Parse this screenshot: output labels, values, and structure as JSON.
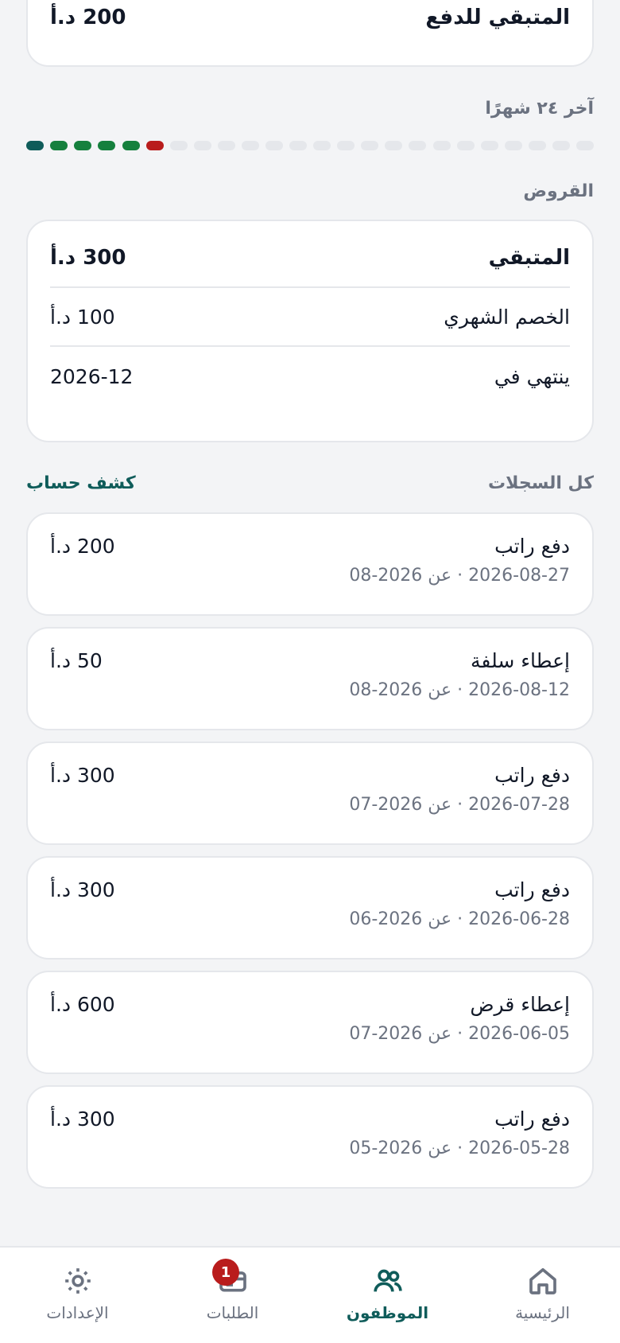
{
  "summary": {
    "label": "المتبقي للدفع",
    "value": "200 د.أ"
  },
  "history": {
    "label": "آخر ٢٤ شهرًا",
    "dots": [
      "#0f5c5a",
      "#15803d",
      "#15803d",
      "#15803d",
      "#15803d",
      "#b91c1c",
      "#e5e7eb",
      "#e5e7eb",
      "#e5e7eb",
      "#e5e7eb",
      "#e5e7eb",
      "#e5e7eb",
      "#e5e7eb",
      "#e5e7eb",
      "#e5e7eb",
      "#e5e7eb",
      "#e5e7eb",
      "#e5e7eb",
      "#e5e7eb",
      "#e5e7eb",
      "#e5e7eb",
      "#e5e7eb",
      "#e5e7eb",
      "#e5e7eb"
    ]
  },
  "loans": {
    "label": "القروض",
    "remaining_label": "المتبقي",
    "remaining_value": "300 د.أ",
    "monthly_label": "الخصم الشهري",
    "monthly_value": "100 د.أ",
    "ends_label": "ينتهي في",
    "ends_value": "2026-12"
  },
  "records": {
    "title": "كل السجلات",
    "statement_link": "كشف حساب",
    "items": [
      {
        "title": "دفع راتب",
        "amount": "200 د.أ",
        "sub": "2026-08-27 · عن 2026-08"
      },
      {
        "title": "إعطاء سلفة",
        "amount": "50 د.أ",
        "sub": "2026-08-12 · عن 2026-08"
      },
      {
        "title": "دفع راتب",
        "amount": "300 د.أ",
        "sub": "2026-07-28 · عن 2026-07"
      },
      {
        "title": "دفع راتب",
        "amount": "300 د.أ",
        "sub": "2026-06-28 · عن 2026-06"
      },
      {
        "title": "إعطاء قرض",
        "amount": "600 د.أ",
        "sub": "2026-06-05 · عن 2026-07"
      },
      {
        "title": "دفع راتب",
        "amount": "300 د.أ",
        "sub": "2026-05-28 · عن 2026-05"
      }
    ]
  },
  "nav": {
    "home": "الرئيسية",
    "employees": "الموظفون",
    "requests": "الطلبات",
    "requests_badge": "1",
    "settings": "الإعدادات"
  }
}
